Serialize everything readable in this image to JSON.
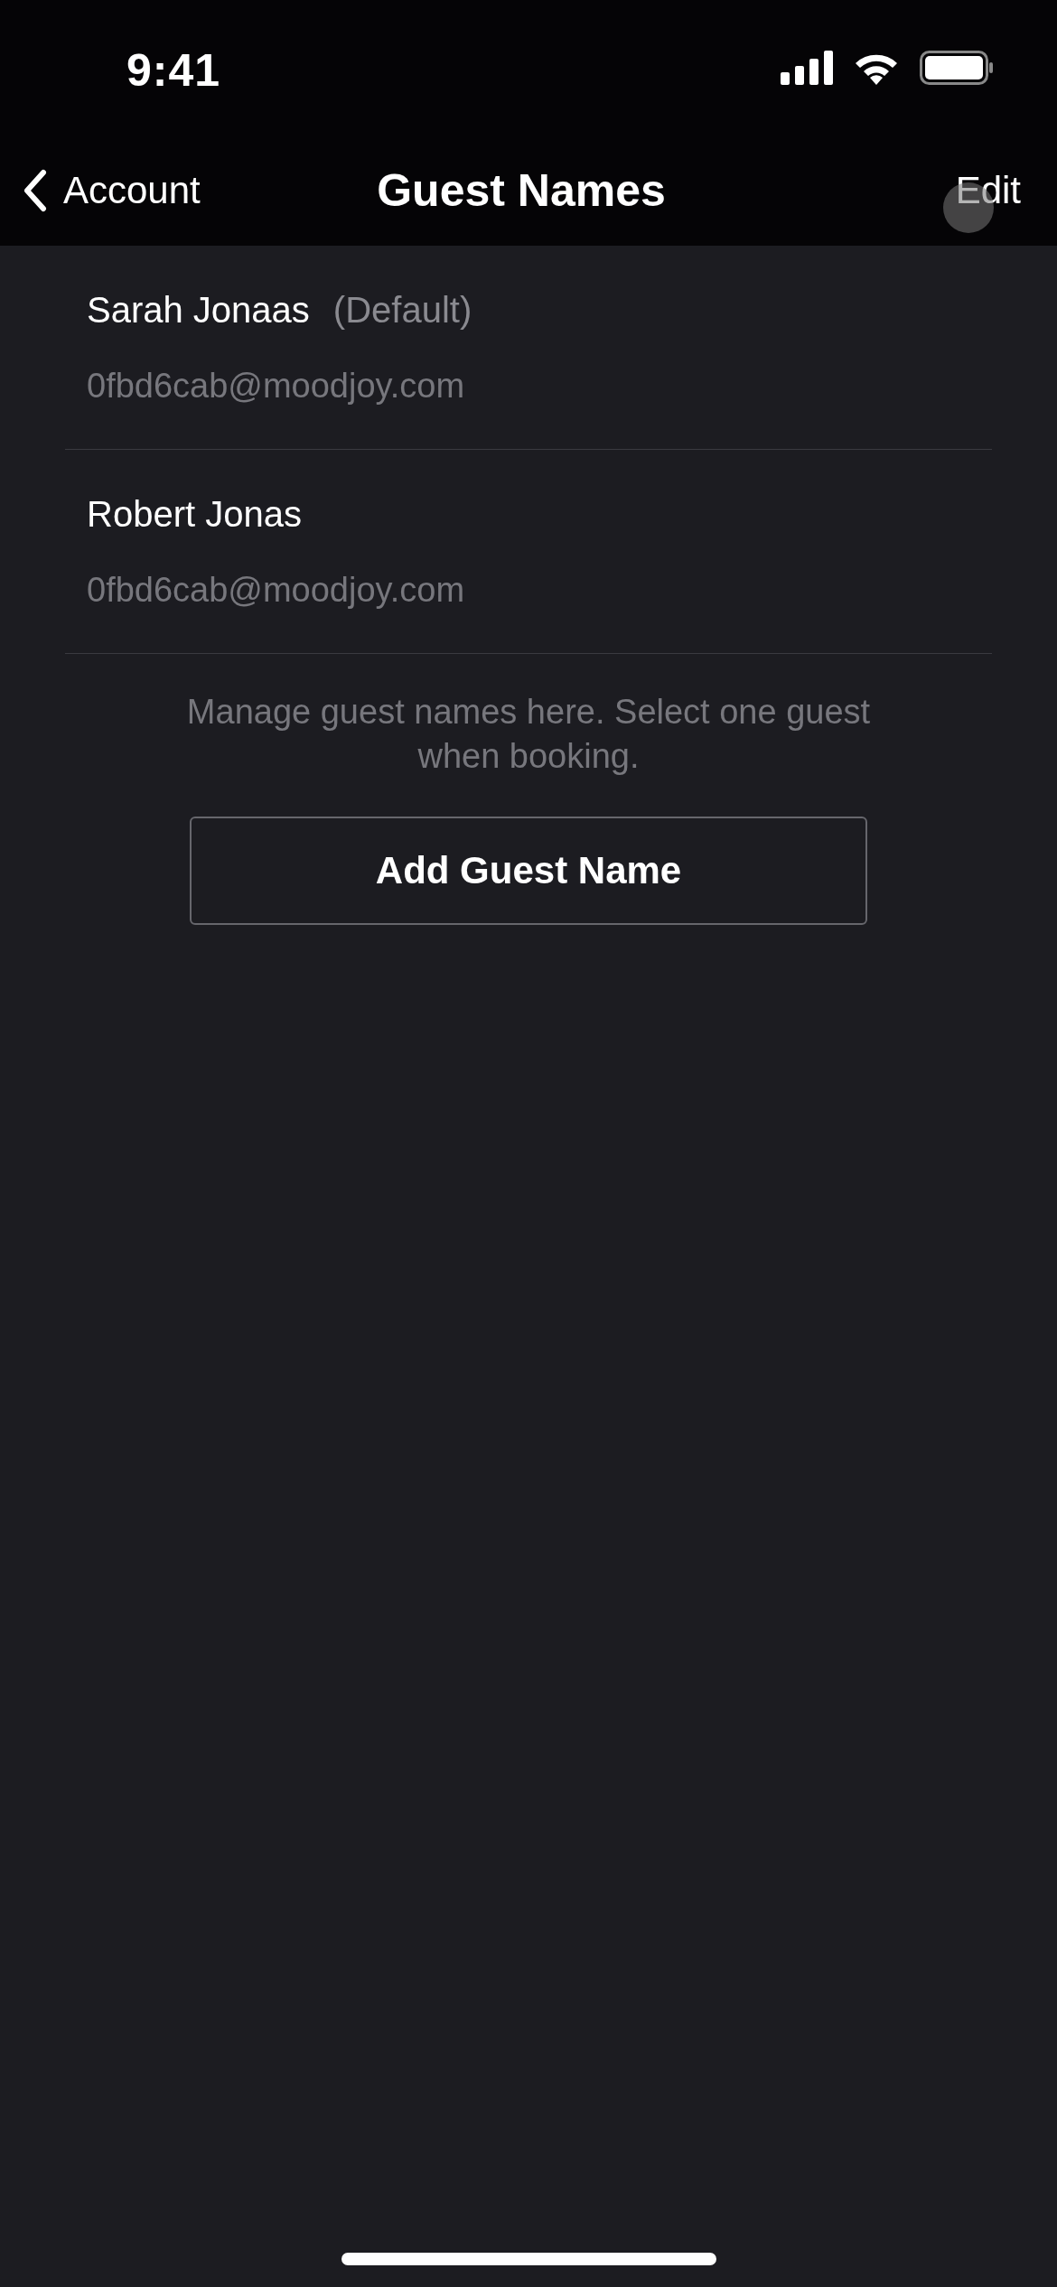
{
  "status_bar": {
    "time": "9:41"
  },
  "nav": {
    "back_label": "Account",
    "title": "Guest Names",
    "action": "Edit"
  },
  "guests": [
    {
      "name": "Sarah Jonaas",
      "tag": "(Default)",
      "email": "0fbd6cab@moodjoy.com"
    },
    {
      "name": "Robert Jonas",
      "email": "0fbd6cab@moodjoy.com"
    }
  ],
  "note": "Manage guest names here. Select one guest when booking.",
  "add_button": "Add Guest Name"
}
